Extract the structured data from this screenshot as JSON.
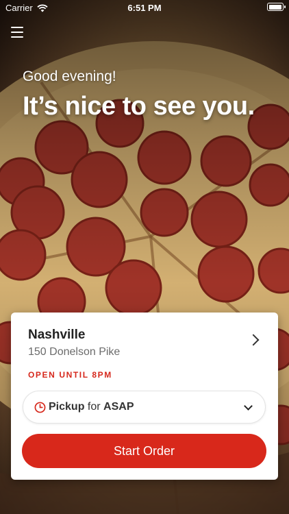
{
  "status_bar": {
    "carrier": "Carrier",
    "time": "6:51 PM",
    "icons": [
      "wifi-icon",
      "battery-icon"
    ]
  },
  "header": {
    "menu_icon": "hamburger-menu-icon"
  },
  "hero": {
    "greeting": "Good evening!",
    "headline": "It’s nice to see you.",
    "background_image": "pepperoni pizza"
  },
  "location_card": {
    "store_name": "Nashville",
    "address": "150 Donelson Pike",
    "open_status": "OPEN UNTIL 8PM",
    "order_mode": {
      "type": "Pickup",
      "connector": "for",
      "time": "ASAP",
      "icon": "clock-icon"
    },
    "start_order_label": "Start Order"
  },
  "colors": {
    "brand_red": "#d8281b",
    "status_red": "#d6281c",
    "card_bg": "#ffffff"
  }
}
